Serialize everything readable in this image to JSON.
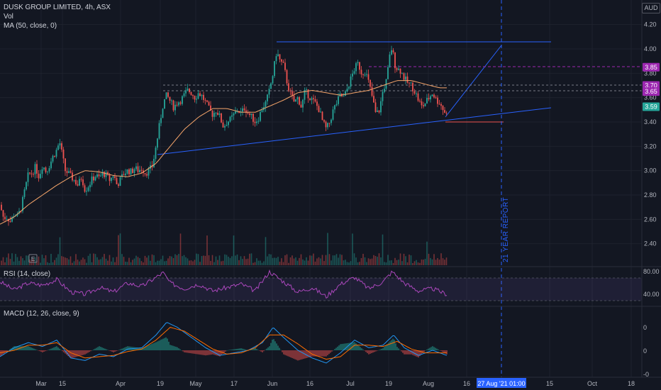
{
  "header": {
    "title": "DUSK GROUP LIMITED, 4h, ASX",
    "vol_label": "Vol",
    "ma_label": "MA (50, close, 0)",
    "currency": "AUD",
    "e_marker": "E"
  },
  "rsi_panel": {
    "label": "RSI (14, close)",
    "ticks": [
      "80.00",
      "40.00"
    ]
  },
  "macd_panel": {
    "label": "MACD (12, 26, close, 9)",
    "ticks": [
      "0",
      "0",
      "-0"
    ]
  },
  "annotation": {
    "text": "21 YEAR  REPORT"
  },
  "chart_data": {
    "type": "candlestick",
    "title": "DUSK GROUP LIMITED, 4h, ASX",
    "y_axis": {
      "min": 2.3,
      "max": 4.3,
      "ticks": [
        "4.20",
        "4.00",
        "3.80",
        "3.60",
        "3.40",
        "3.20",
        "3.00",
        "2.80",
        "2.60",
        "2.40"
      ]
    },
    "x_axis": {
      "ticks": [
        "Mar",
        "15",
        "Apr",
        "19",
        "May",
        "17",
        "Jun",
        "16",
        "Jul",
        "19",
        "Aug",
        "16",
        "15",
        "Oct",
        "18"
      ],
      "cursor_label": "27 Aug '21  01:00"
    },
    "price_labels": [
      {
        "text": "3.85",
        "value": 3.85
      },
      {
        "text": "3.70",
        "value": 3.7
      },
      {
        "text": "3.65",
        "value": 3.65
      },
      {
        "text": "3.59",
        "value": 3.525
      }
    ],
    "price_path": [
      [
        0,
        2.72
      ],
      [
        5,
        2.61
      ],
      [
        10,
        2.62
      ],
      [
        15,
        2.58
      ],
      [
        20,
        2.65
      ],
      [
        25,
        2.62
      ],
      [
        30,
        2.7
      ],
      [
        35,
        2.84
      ],
      [
        40,
        2.97
      ],
      [
        45,
        2.98
      ],
      [
        50,
        3.03
      ],
      [
        55,
        2.95
      ],
      [
        60,
        3.05
      ],
      [
        65,
        2.99
      ],
      [
        70,
        3.05
      ],
      [
        75,
        3.12
      ],
      [
        80,
        3.17
      ],
      [
        84,
        3.24
      ],
      [
        88,
        3.12
      ],
      [
        92,
        3.0
      ],
      [
        96,
        2.98
      ],
      [
        100,
        2.95
      ],
      [
        105,
        2.92
      ],
      [
        110,
        2.88
      ],
      [
        115,
        2.95
      ],
      [
        120,
        2.84
      ],
      [
        125,
        2.88
      ],
      [
        130,
        2.93
      ],
      [
        135,
        2.96
      ],
      [
        140,
        2.94
      ],
      [
        145,
        2.98
      ],
      [
        150,
        2.96
      ],
      [
        155,
        2.92
      ],
      [
        160,
        2.97
      ],
      [
        165,
        2.88
      ],
      [
        170,
        2.93
      ],
      [
        175,
        2.98
      ],
      [
        180,
        3.0
      ],
      [
        185,
        2.99
      ],
      [
        190,
        3.02
      ],
      [
        195,
        3.0
      ],
      [
        200,
        3.02
      ],
      [
        205,
        2.98
      ],
      [
        210,
        3.0
      ],
      [
        215,
        3.04
      ],
      [
        220,
        3.2
      ],
      [
        225,
        3.38
      ],
      [
        230,
        3.55
      ],
      [
        235,
        3.62
      ],
      [
        240,
        3.57
      ],
      [
        245,
        3.52
      ],
      [
        250,
        3.56
      ],
      [
        255,
        3.58
      ],
      [
        260,
        3.62
      ],
      [
        265,
        3.66
      ],
      [
        270,
        3.64
      ],
      [
        275,
        3.6
      ],
      [
        280,
        3.64
      ],
      [
        285,
        3.61
      ],
      [
        290,
        3.56
      ],
      [
        295,
        3.5
      ],
      [
        300,
        3.46
      ],
      [
        305,
        3.5
      ],
      [
        310,
        3.44
      ],
      [
        315,
        3.36
      ],
      [
        320,
        3.4
      ],
      [
        325,
        3.42
      ],
      [
        330,
        3.46
      ],
      [
        335,
        3.5
      ],
      [
        340,
        3.47
      ],
      [
        345,
        3.52
      ],
      [
        350,
        3.47
      ],
      [
        355,
        3.44
      ],
      [
        360,
        3.4
      ],
      [
        365,
        3.44
      ],
      [
        370,
        3.52
      ],
      [
        375,
        3.56
      ],
      [
        380,
        3.66
      ],
      [
        385,
        3.8
      ],
      [
        390,
        3.98
      ],
      [
        395,
        3.9
      ],
      [
        400,
        3.86
      ],
      [
        405,
        3.72
      ],
      [
        410,
        3.62
      ],
      [
        415,
        3.56
      ],
      [
        420,
        3.6
      ],
      [
        425,
        3.52
      ],
      [
        430,
        3.65
      ],
      [
        435,
        3.62
      ],
      [
        440,
        3.58
      ],
      [
        445,
        3.55
      ],
      [
        450,
        3.5
      ],
      [
        455,
        3.4
      ],
      [
        460,
        3.34
      ],
      [
        465,
        3.4
      ],
      [
        470,
        3.5
      ],
      [
        475,
        3.56
      ],
      [
        480,
        3.62
      ],
      [
        485,
        3.6
      ],
      [
        490,
        3.68
      ],
      [
        495,
        3.76
      ],
      [
        500,
        3.84
      ],
      [
        505,
        3.88
      ],
      [
        510,
        3.8
      ],
      [
        515,
        3.82
      ],
      [
        520,
        3.72
      ],
      [
        525,
        3.6
      ],
      [
        530,
        3.46
      ],
      [
        535,
        3.5
      ],
      [
        540,
        3.66
      ],
      [
        545,
        3.74
      ],
      [
        550,
        3.96
      ],
      [
        553,
        4.02
      ],
      [
        556,
        3.88
      ],
      [
        560,
        3.84
      ],
      [
        565,
        3.82
      ],
      [
        570,
        3.76
      ],
      [
        575,
        3.72
      ],
      [
        580,
        3.7
      ],
      [
        585,
        3.65
      ],
      [
        590,
        3.58
      ],
      [
        595,
        3.52
      ],
      [
        600,
        3.56
      ],
      [
        605,
        3.6
      ],
      [
        610,
        3.64
      ],
      [
        615,
        3.58
      ],
      [
        620,
        3.56
      ],
      [
        625,
        3.5
      ],
      [
        630,
        3.46
      ]
    ],
    "moving_average": [
      [
        0,
        2.56
      ],
      [
        20,
        2.62
      ],
      [
        40,
        2.72
      ],
      [
        60,
        2.8
      ],
      [
        80,
        2.88
      ],
      [
        100,
        2.95
      ],
      [
        120,
        3.0
      ],
      [
        140,
        2.99
      ],
      [
        160,
        2.96
      ],
      [
        180,
        2.95
      ],
      [
        200,
        2.98
      ],
      [
        220,
        3.06
      ],
      [
        240,
        3.2
      ],
      [
        260,
        3.34
      ],
      [
        280,
        3.44
      ],
      [
        300,
        3.51
      ],
      [
        320,
        3.51
      ],
      [
        340,
        3.48
      ],
      [
        360,
        3.48
      ],
      [
        380,
        3.53
      ],
      [
        400,
        3.58
      ],
      [
        420,
        3.64
      ],
      [
        440,
        3.66
      ],
      [
        460,
        3.64
      ],
      [
        480,
        3.62
      ],
      [
        500,
        3.64
      ],
      [
        520,
        3.66
      ],
      [
        540,
        3.7
      ],
      [
        560,
        3.74
      ],
      [
        580,
        3.74
      ],
      [
        600,
        3.71
      ],
      [
        620,
        3.68
      ],
      [
        630,
        3.68
      ]
    ],
    "rsi": [
      [
        0,
        62
      ],
      [
        20,
        48
      ],
      [
        40,
        60
      ],
      [
        60,
        56
      ],
      [
        80,
        66
      ],
      [
        100,
        44
      ],
      [
        120,
        40
      ],
      [
        140,
        52
      ],
      [
        160,
        44
      ],
      [
        180,
        60
      ],
      [
        200,
        54
      ],
      [
        220,
        70
      ],
      [
        230,
        78
      ],
      [
        240,
        60
      ],
      [
        260,
        50
      ],
      [
        280,
        58
      ],
      [
        300,
        46
      ],
      [
        320,
        52
      ],
      [
        340,
        58
      ],
      [
        360,
        46
      ],
      [
        380,
        80
      ],
      [
        400,
        62
      ],
      [
        420,
        44
      ],
      [
        440,
        52
      ],
      [
        460,
        36
      ],
      [
        480,
        58
      ],
      [
        500,
        70
      ],
      [
        520,
        50
      ],
      [
        540,
        62
      ],
      [
        553,
        80
      ],
      [
        570,
        60
      ],
      [
        590,
        46
      ],
      [
        610,
        50
      ],
      [
        630,
        40
      ]
    ],
    "macd": [
      [
        0,
        -0.5
      ],
      [
        20,
        0.2
      ],
      [
        40,
        0.6
      ],
      [
        60,
        0.3
      ],
      [
        80,
        0.8
      ],
      [
        100,
        -0.6
      ],
      [
        120,
        -0.8
      ],
      [
        140,
        -0.3
      ],
      [
        160,
        -0.5
      ],
      [
        180,
        0.1
      ],
      [
        200,
        0.2
      ],
      [
        220,
        1.2
      ],
      [
        235,
        2.2
      ],
      [
        250,
        1.8
      ],
      [
        270,
        1.0
      ],
      [
        290,
        0.2
      ],
      [
        310,
        -0.4
      ],
      [
        330,
        -0.2
      ],
      [
        350,
        0.0
      ],
      [
        370,
        0.6
      ],
      [
        385,
        1.8
      ],
      [
        400,
        1.0
      ],
      [
        420,
        0.0
      ],
      [
        440,
        -0.6
      ],
      [
        460,
        -1.0
      ],
      [
        480,
        -0.2
      ],
      [
        500,
        0.8
      ],
      [
        520,
        0.2
      ],
      [
        540,
        0.4
      ],
      [
        555,
        1.2
      ],
      [
        570,
        0.2
      ],
      [
        590,
        -0.4
      ],
      [
        610,
        0.0
      ],
      [
        630,
        -0.4
      ]
    ],
    "macd_signal": [
      [
        0,
        -0.2
      ],
      [
        20,
        0.0
      ],
      [
        40,
        0.4
      ],
      [
        60,
        0.4
      ],
      [
        80,
        0.6
      ],
      [
        100,
        -0.2
      ],
      [
        120,
        -0.6
      ],
      [
        140,
        -0.5
      ],
      [
        160,
        -0.4
      ],
      [
        180,
        -0.1
      ],
      [
        200,
        0.1
      ],
      [
        220,
        0.8
      ],
      [
        240,
        1.8
      ],
      [
        260,
        1.5
      ],
      [
        280,
        0.8
      ],
      [
        300,
        0.1
      ],
      [
        320,
        -0.3
      ],
      [
        340,
        -0.2
      ],
      [
        360,
        0.2
      ],
      [
        380,
        1.2
      ],
      [
        400,
        1.2
      ],
      [
        420,
        0.5
      ],
      [
        440,
        -0.3
      ],
      [
        460,
        -0.7
      ],
      [
        480,
        -0.5
      ],
      [
        500,
        0.4
      ],
      [
        520,
        0.4
      ],
      [
        540,
        0.3
      ],
      [
        560,
        0.7
      ],
      [
        580,
        0.1
      ],
      [
        600,
        -0.2
      ],
      [
        630,
        -0.2
      ]
    ],
    "legend": {
      "series": [
        "MA (50, close, 0)",
        "RSI (14, close)",
        "MACD (12, 26, close, 9)"
      ]
    },
    "grid": true,
    "colors": {
      "background": "#131722",
      "up": "#26a69a",
      "down": "#ef5350",
      "ma": "#f7a66b",
      "trendline": "#2962ff",
      "rsi": "#9c27b0",
      "macd": "#2196f3",
      "signal": "#ff6d00"
    }
  }
}
